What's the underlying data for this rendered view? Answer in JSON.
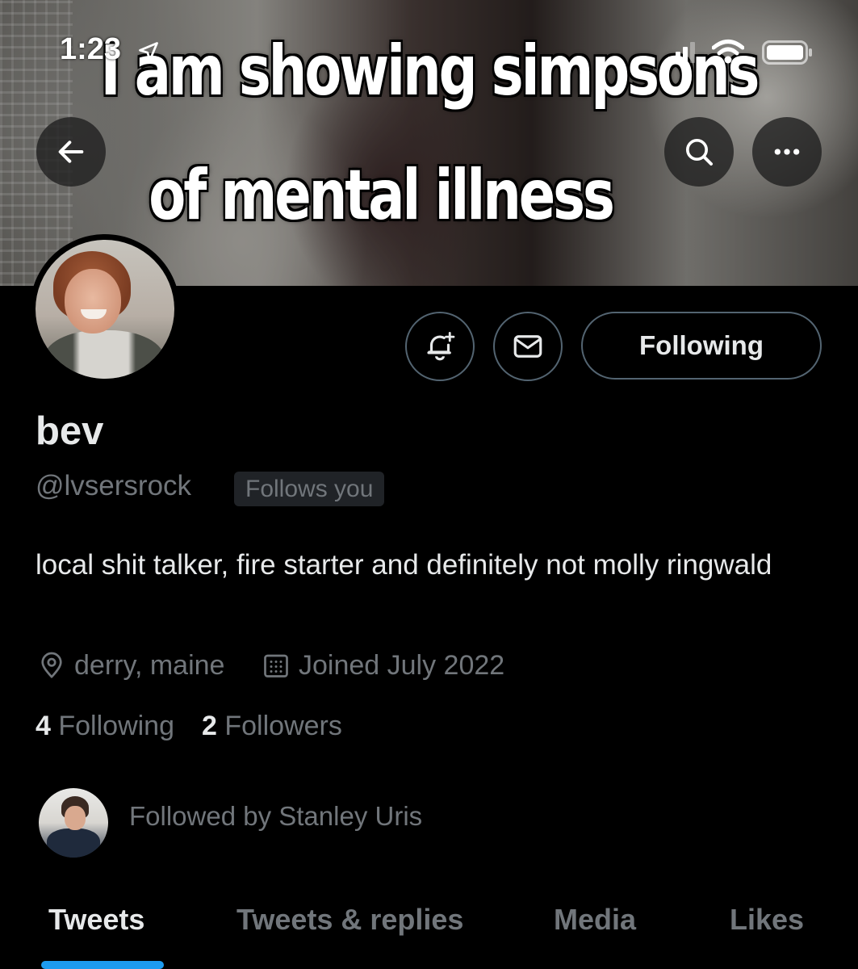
{
  "status_bar": {
    "time": "1:23"
  },
  "banner": {
    "caption_line1": "I am showing simpsons",
    "caption_line2": "of mental illness"
  },
  "profile": {
    "name": "bev",
    "handle": "@lvsersrock",
    "follows_you_badge": "Follows you",
    "bio": "local shit talker, fire starter and definitely not molly ringwald",
    "location": "derry, maine",
    "joined": "Joined July 2022",
    "following_count": "4",
    "following_label": "Following",
    "followers_count": "2",
    "followers_label": "Followers",
    "followed_by": "Followed by Stanley Uris"
  },
  "actions": {
    "following_button": "Following"
  },
  "tabs": [
    {
      "label": "Tweets",
      "active": true
    },
    {
      "label": "Tweets & replies",
      "active": false
    },
    {
      "label": "Media",
      "active": false
    },
    {
      "label": "Likes",
      "active": false
    }
  ],
  "icons": {
    "back": "arrow-left-icon",
    "search": "search-icon",
    "more": "more-icon",
    "notify": "bell-plus-icon",
    "message": "envelope-icon",
    "location": "map-pin-icon",
    "calendar": "calendar-icon"
  },
  "colors": {
    "accent": "#1d9bf0",
    "background": "#000000",
    "secondary_text": "#71767b"
  }
}
